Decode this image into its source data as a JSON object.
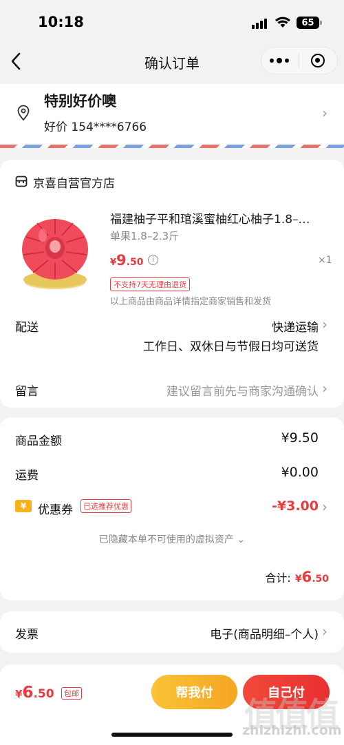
{
  "status_bar": {
    "time": "10:18",
    "battery": "65"
  },
  "nav": {
    "title": "确认订单"
  },
  "address": {
    "name": "特别好价噢",
    "phone": "好价 154****6766"
  },
  "shop": {
    "name": "京喜自营官方店"
  },
  "product": {
    "title": "福建柚子平和琯溪蜜柚红心柚子1.8–…",
    "spec": "单果1.8–2.3斤",
    "price_symbol": "¥",
    "price_int": "9",
    "price_dec": ".50",
    "qty": "×1",
    "return_tag": "不支持7天无理由退货",
    "note": "以上商品由商品详情指定商家销售和发货"
  },
  "delivery": {
    "label": "配送",
    "method": "快递运输",
    "note": "工作日、双休日与节假日均可送货"
  },
  "message": {
    "label": "留言",
    "placeholder": "建议留言前先与商家沟通确认"
  },
  "amounts": {
    "goods_label": "商品金额",
    "goods_value": "¥9.50",
    "shipping_label": "运费",
    "shipping_value": "¥0.00",
    "coupon_icon": "¥",
    "coupon_label": "优惠券",
    "coupon_tag": "已选推荐优惠",
    "coupon_value": "-¥3.00",
    "hidden_assets": "已隐藏本单不可使用的虚拟资产",
    "total_label": "合计:",
    "total_symbol": "¥",
    "total_int": "6",
    "total_dec": ".50"
  },
  "invoice": {
    "label": "发票",
    "value": "电子(商品明细–个人)"
  },
  "bottom": {
    "total_symbol": "¥",
    "total_int": "6",
    "total_dec": ".50",
    "free_shipping": "包邮",
    "help_pay": "帮我付",
    "self_pay": "自己付"
  },
  "watermark": {
    "text": "值值值",
    "url": "zhizhizhi.com"
  },
  "colors": {
    "accent_red": "#e93b3d",
    "accent_yellow": "#f7b11b"
  }
}
